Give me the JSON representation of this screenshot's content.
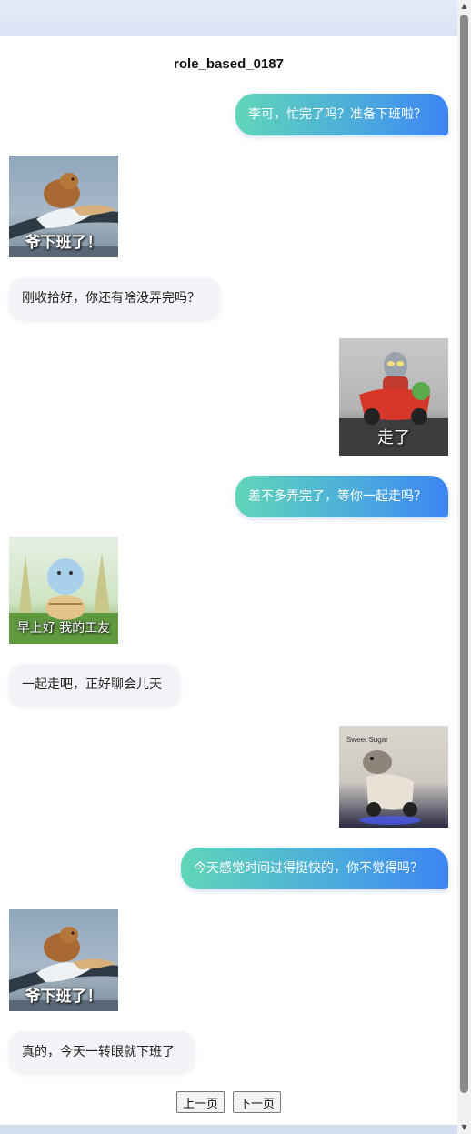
{
  "page": {
    "title": "role_based_0187"
  },
  "messages": [
    {
      "side": "right",
      "type": "text",
      "text": "李可，忙完了吗？准备下班啦？"
    },
    {
      "side": "left",
      "type": "sticker",
      "caption": "爷下班了！",
      "icon": "capybara-riding-pelican-sticker"
    },
    {
      "side": "left",
      "type": "text",
      "text": "刚收拾好，你还有啥没弄完吗？"
    },
    {
      "side": "right",
      "type": "sticker",
      "caption": "走了",
      "icon": "ultraman-toy-car-sticker"
    },
    {
      "side": "right",
      "type": "text",
      "text": "差不多弄完了，等你一起走吗？"
    },
    {
      "side": "left",
      "type": "sticker",
      "caption": "早上好 我的工友",
      "icon": "squirtle-sticker"
    },
    {
      "side": "left",
      "type": "text",
      "text": "一起走吧，正好聊会儿天"
    },
    {
      "side": "right",
      "type": "sticker",
      "caption": "",
      "icon": "hamster-scooter-sticker"
    },
    {
      "side": "right",
      "type": "text",
      "text": "今天感觉时间过得挺快的，你不觉得吗？"
    },
    {
      "side": "left",
      "type": "sticker",
      "caption": "爷下班了！",
      "icon": "capybara-riding-pelican-sticker"
    },
    {
      "side": "left",
      "type": "text",
      "text": "真的，今天一转眼就下班了"
    }
  ],
  "pager": {
    "prev_label": "上一页",
    "next_label": "下一页"
  },
  "colors": {
    "right_bubble_start": "#60d6b8",
    "right_bubble_end": "#3d84f2",
    "left_bubble": "#f2f4f8"
  }
}
